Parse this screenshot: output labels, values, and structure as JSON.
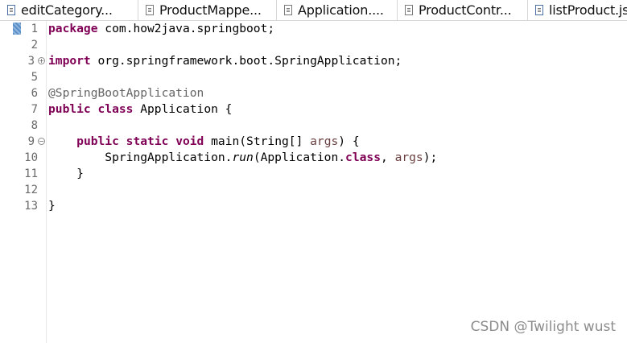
{
  "tabs": [
    {
      "label": "editCategory..."
    },
    {
      "label": "ProductMappe..."
    },
    {
      "label": "Application...."
    },
    {
      "label": "ProductContr..."
    },
    {
      "label": "listProduct.jsp"
    }
  ],
  "editor": {
    "line_numbers": [
      "1",
      "2",
      "3",
      "5",
      "6",
      "7",
      "8",
      "9",
      "10",
      "11",
      "12",
      "13"
    ],
    "code": {
      "l1_kw": "package",
      "l1_rest": " com.how2java.springboot;",
      "l3_kw": "import",
      "l3_rest": " org.springframework.boot.SpringApplication;",
      "l6": "@SpringBootApplication",
      "l7_kw1": "public",
      "l7_kw2": "class",
      "l7_rest": " Application {",
      "l9_kw1": "public",
      "l9_kw2": "static",
      "l9_kw3": "void",
      "l9_rest": " main(String[] ",
      "l9_arg": "args",
      "l9_end": ") {",
      "l10_a": "SpringApplication.",
      "l10_run": "run",
      "l10_b": "(Application.",
      "l10_kw": "class",
      "l10_c": ", ",
      "l10_arg": "args",
      "l10_d": ");",
      "l11": "}",
      "l13": "}"
    }
  },
  "watermark": "CSDN @Twilight wust"
}
